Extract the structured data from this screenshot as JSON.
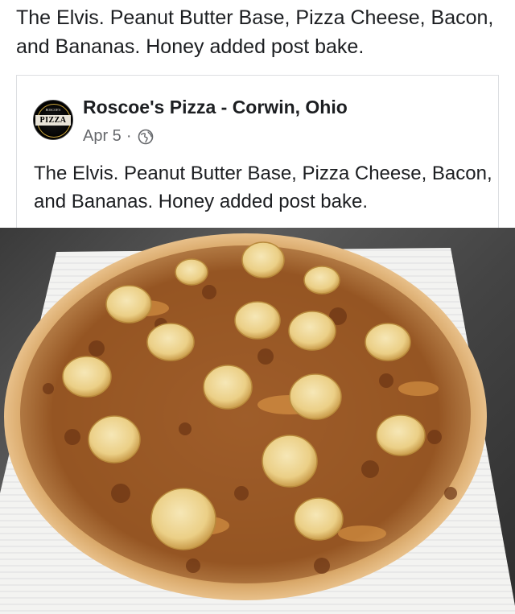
{
  "post": {
    "caption": "The Elvis. Peanut Butter Base, Pizza Cheese, Bacon, and Bananas. Honey added post bake."
  },
  "shared_post": {
    "page_name": "Roscoe's Pizza - Corwin, Ohio",
    "date": "Apr 5",
    "separator": "·",
    "privacy_icon": "globe-icon",
    "text": "The Elvis. Peanut Butter Base, Pizza Cheese, Bacon, and Bananas. Honey added post bake.",
    "avatar": {
      "logo_top": "ROSCOE'S",
      "logo_text": "PIZZA"
    }
  },
  "photo": {
    "subject": "pizza-photo"
  }
}
